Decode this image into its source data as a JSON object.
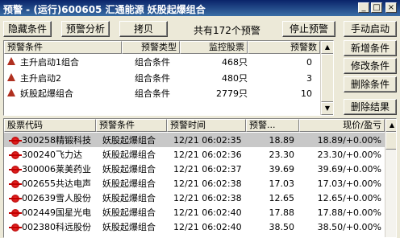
{
  "window": {
    "title": "预警 - (运行)600605 汇通能源 妖股起爆组合",
    "minimize": "_",
    "maximize": "□",
    "close": "×"
  },
  "toolbar": {
    "hide_condition": "隐藏条件",
    "warning_analysis": "预警分析",
    "copy": "拷贝",
    "total_text": "共有172个预警",
    "stop_warning": "停止预警",
    "manual_start": "手动启动",
    "add_condition": "新增条件",
    "modify_condition": "修改条件",
    "delete_condition": "删除条件",
    "delete_result": "删除结果"
  },
  "conditions": {
    "columns": [
      "预警条件",
      "预警类型",
      "监控股票",
      "预警数"
    ],
    "rows": [
      {
        "name": "主升启动1组合",
        "type": "组合条件",
        "stocks": "468只",
        "count": "0"
      },
      {
        "name": "主升启动2",
        "type": "组合条件",
        "stocks": "480只",
        "count": "3"
      },
      {
        "name": "妖股起爆组合",
        "type": "组合条件",
        "stocks": "2779只",
        "count": "10"
      }
    ]
  },
  "results": {
    "columns": [
      "股票代码",
      "预警条件",
      "预警时间",
      "预警...",
      "现价/盈亏"
    ],
    "rows": [
      {
        "code": "300258",
        "name": "精锻科技",
        "cond": "妖股起爆组合",
        "time": "12/21  06:02:35",
        "price": "18.89",
        "now": "18.89/+0.00%"
      },
      {
        "code": "300240",
        "name": "飞力达",
        "cond": "妖股起爆组合",
        "time": "12/21  06:02:36",
        "price": "23.30",
        "now": "23.30/+0.00%"
      },
      {
        "code": "300006",
        "name": "莱美药业",
        "cond": "妖股起爆组合",
        "time": "12/21  06:02:37",
        "price": "39.69",
        "now": "39.69/+0.00%"
      },
      {
        "code": "002655",
        "name": "共达电声",
        "cond": "妖股起爆组合",
        "time": "12/21  06:02:38",
        "price": "17.03",
        "now": "17.03/+0.00%"
      },
      {
        "code": "002639",
        "name": "雪人股份",
        "cond": "妖股起爆组合",
        "time": "12/21  06:02:38",
        "price": "12.65",
        "now": "12.65/+0.00%"
      },
      {
        "code": "002449",
        "name": "国星光电",
        "cond": "妖股起爆组合",
        "time": "12/21  06:02:40",
        "price": "17.88",
        "now": "17.88/+0.00%"
      },
      {
        "code": "002380",
        "name": "科远股份",
        "cond": "妖股起爆组合",
        "time": "12/21  06:02:40",
        "price": "38.50",
        "now": "38.50/+0.00%"
      }
    ]
  }
}
